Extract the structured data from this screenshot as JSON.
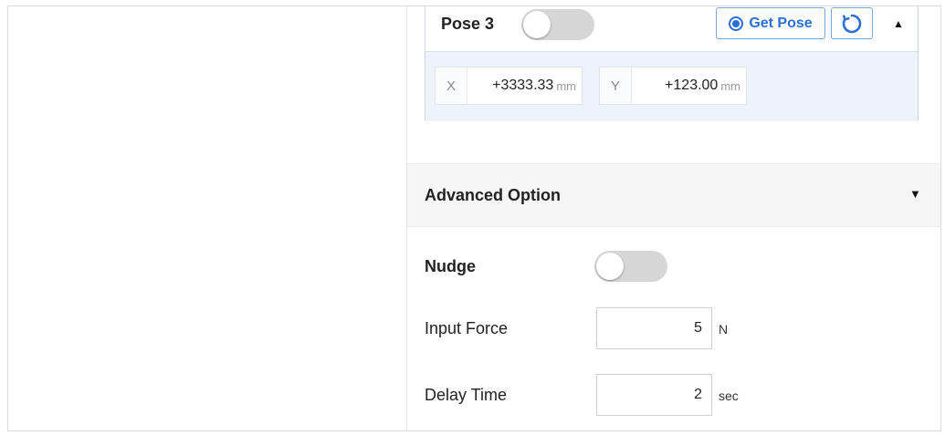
{
  "pose": {
    "title": "Pose 3",
    "enabled": false,
    "get_pose_label": "Get Pose",
    "coords": [
      {
        "axis": "X",
        "value": "+3333.33",
        "unit": "mm"
      },
      {
        "axis": "Y",
        "value": "+123.00",
        "unit": "mm"
      }
    ]
  },
  "advanced": {
    "title": "Advanced Option",
    "nudge": {
      "label": "Nudge",
      "enabled": false
    },
    "input_force": {
      "label": "Input Force",
      "value": "5",
      "unit": "N"
    },
    "delay_time": {
      "label": "Delay Time",
      "value": "2",
      "unit": "sec"
    }
  },
  "colors": {
    "accent": "#2b6fd6",
    "card_bg": "#eef3fb",
    "toggle_off": "#d6d6d6"
  }
}
